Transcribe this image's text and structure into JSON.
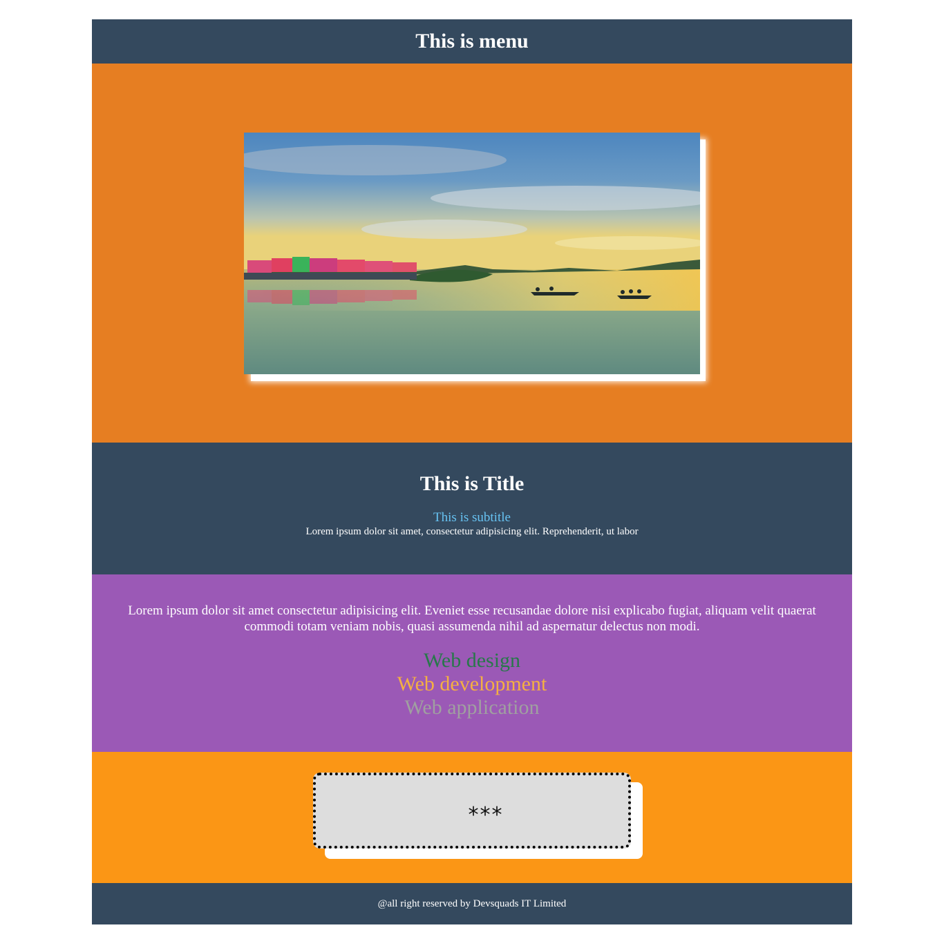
{
  "menu": {
    "title": "This is menu"
  },
  "hero": {
    "image_alt": "river landscape with colorful houses and boats at sunset"
  },
  "title_section": {
    "title": "This is Title",
    "subtitle": "This is subtitle",
    "text": "Lorem ipsum dolor sit amet, consectetur adipisicing elit. Reprehenderit, ut labor"
  },
  "purple_section": {
    "paragraph": "Lorem ipsum dolor sit amet consectetur adipisicing elit. Eveniet esse recusandae dolore nisi explicabo fugiat, aliquam velit quaerat commodi totam veniam nobis, quasi assumenda nihil ad aspernatur delectus non modi.",
    "services": [
      "Web design",
      "Web development",
      "Web application"
    ]
  },
  "box_section": {
    "text": "***"
  },
  "footer": {
    "text": "@all right reserved by Devsquads IT Limited"
  },
  "colors": {
    "dark": "#34495e",
    "orange": "#e67e22",
    "purple": "#9b59b6",
    "light_orange": "#fb9615",
    "subtitle": "#67c3f3",
    "web_design": "#27784a",
    "web_development": "#f5b041",
    "web_application": "#a0a0a0"
  }
}
